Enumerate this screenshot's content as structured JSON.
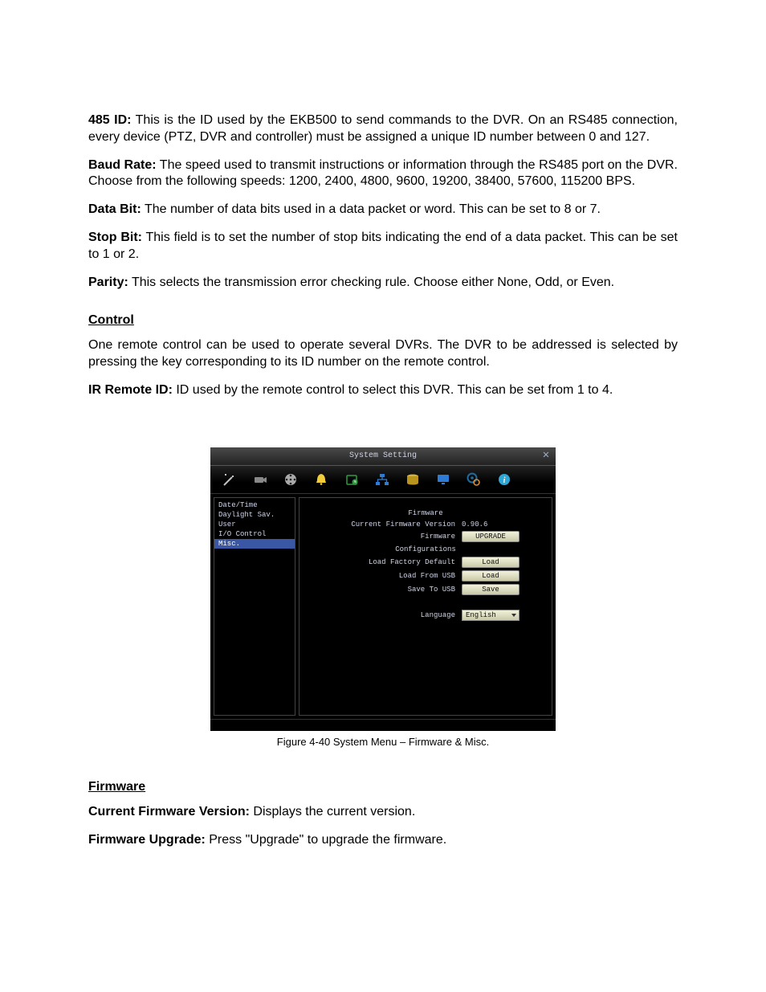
{
  "doc": {
    "p1": {
      "b": "485 ID:",
      "t": " This is the ID used by the EKB500 to send commands to the DVR. On an RS485 connection, every device (PTZ, DVR and controller) must be assigned a unique ID number between 0 and 127."
    },
    "p2": {
      "b": "Baud Rate:",
      "t": " The speed used to transmit instructions or information through the RS485 port on the DVR. Choose from the following speeds: 1200, 2400, 4800, 9600, 19200, 38400, 57600, 115200 BPS."
    },
    "p3": {
      "b": "Data Bit:",
      "t": " The number of data bits used in a data packet or word. This can be set to 8 or 7."
    },
    "p4": {
      "b": "Stop Bit:",
      "t": " This field is to set the number of stop bits indicating the end of a data packet. This can be set to 1 or 2."
    },
    "p5": {
      "b": "Parity:",
      "t": " This selects the transmission error checking rule. Choose either None, Odd, or Even."
    },
    "hControl": "Control",
    "p6": "One remote control can be used to operate several DVRs. The DVR to be addressed is selected by pressing the key corresponding to its ID number on the remote control.",
    "p7": {
      "b": "IR Remote ID:",
      "t": " ID used by the remote control to select this DVR. This can be set from 1 to 4."
    },
    "caption": "Figure 4-40 System Menu – Firmware & Misc.",
    "hFirmware": "Firmware",
    "p8": {
      "b": "Current Firmware Version:",
      "t": " Displays the current version."
    },
    "p9": {
      "b": "Firmware Upgrade:",
      "t": " Press \"Upgrade\" to upgrade the firmware."
    }
  },
  "scr": {
    "title": "System Setting",
    "side": [
      "Date/Time",
      "Daylight Sav.",
      "User",
      "I/O Control",
      "Misc."
    ],
    "hdgFirmware": "Firmware",
    "verLabel": "Current Firmware Version",
    "verValue": "0.90.6",
    "fwLabel": "Firmware",
    "btnUpgrade": "UPGRADE",
    "hdgConfig": "Configurations",
    "factLabel": "Load Factory Default",
    "btnLoad1": "Load",
    "usbLabel": "Load From USB",
    "btnLoad2": "Load",
    "saveLabel": "Save To USB",
    "btnSave": "Save",
    "langLabel": "Language",
    "langValue": "English"
  }
}
